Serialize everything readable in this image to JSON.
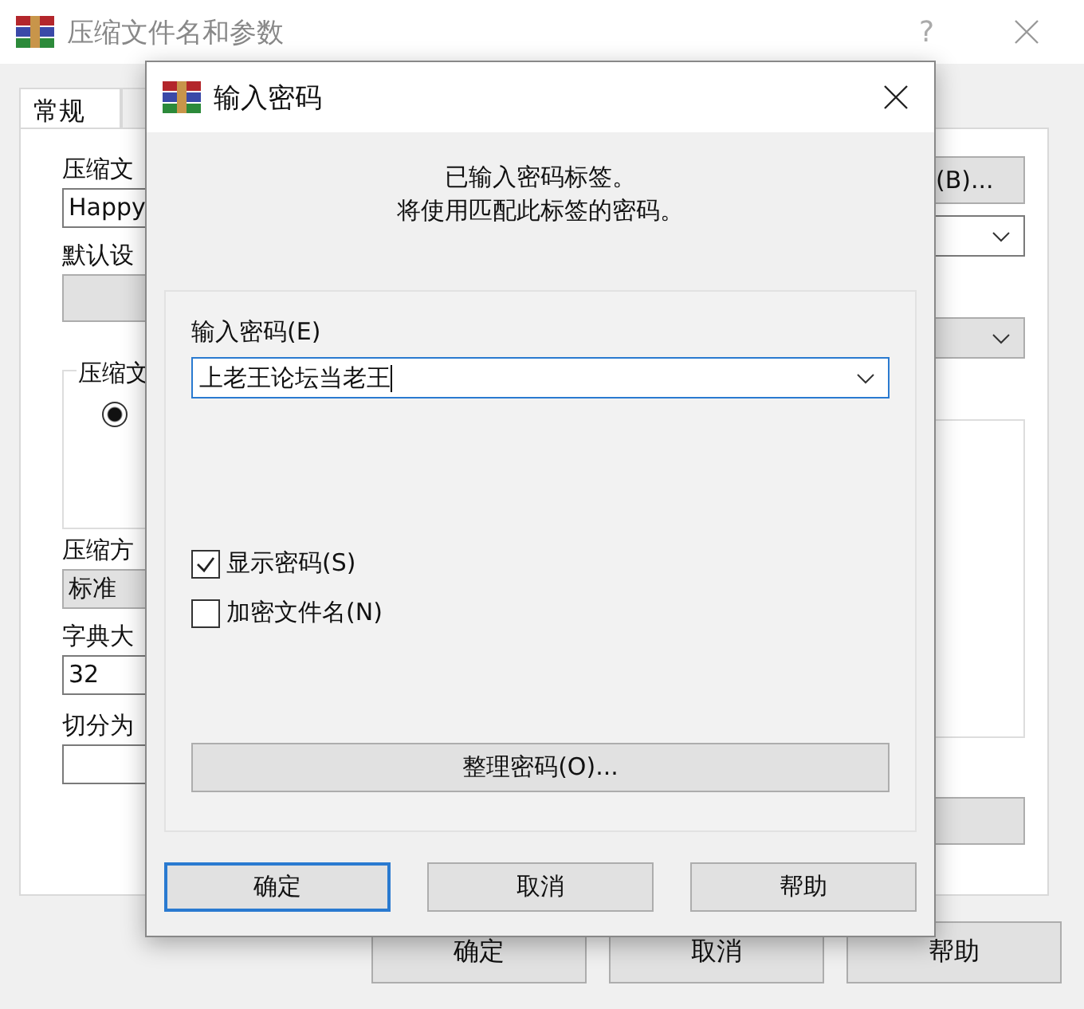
{
  "window": {
    "title": "压缩文件名和参数",
    "help": "?"
  },
  "tabs": [
    {
      "label": "常规",
      "selected": true
    }
  ],
  "background_form": {
    "archive_name_label": "压缩文",
    "archive_name_value": "Happy",
    "browse_button": "(B)...",
    "profile_label": "默认设",
    "format_group_label": "压缩文",
    "format_radio_checked": true,
    "method_label": "压缩方",
    "method_value": "标准",
    "dictionary_label": "字典大",
    "dictionary_value": "32",
    "split_label": "切分为"
  },
  "footer_buttons": [
    {
      "label": "确定"
    },
    {
      "label": "取消"
    },
    {
      "label": "帮助"
    }
  ],
  "password_dialog": {
    "title": "输入密码",
    "message_lines": [
      "已输入密码标签。",
      "将使用匹配此标签的密码。"
    ],
    "password_label": "输入密码(E)",
    "password_value": "上老王论坛当老王",
    "options": [
      {
        "label": "显示密码(S)",
        "checked": true
      },
      {
        "label": "加密文件名(N)",
        "checked": false
      }
    ],
    "organize_button": "整理密码(O)...",
    "buttons": [
      {
        "label": "确定",
        "default": true
      },
      {
        "label": "取消",
        "default": false
      },
      {
        "label": "帮助",
        "default": false
      }
    ]
  }
}
